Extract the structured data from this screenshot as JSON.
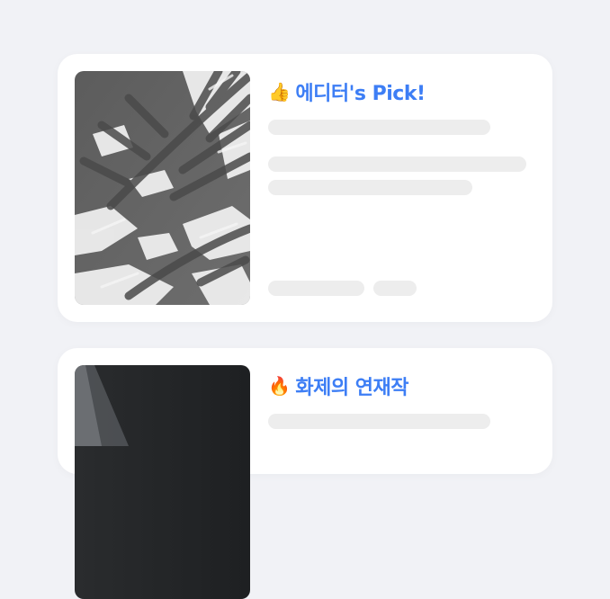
{
  "cards": [
    {
      "title": "에디터's Pick!",
      "emoji": "👍",
      "title_color": "#3d7ef5",
      "thumbnail": "palm-leaf-shadow-photo"
    },
    {
      "title": "화제의 연재작",
      "emoji": "🔥",
      "title_color": "#3d7ef5",
      "thumbnail": "dark-cover-photo"
    }
  ],
  "placeholder_color": "#ededed"
}
